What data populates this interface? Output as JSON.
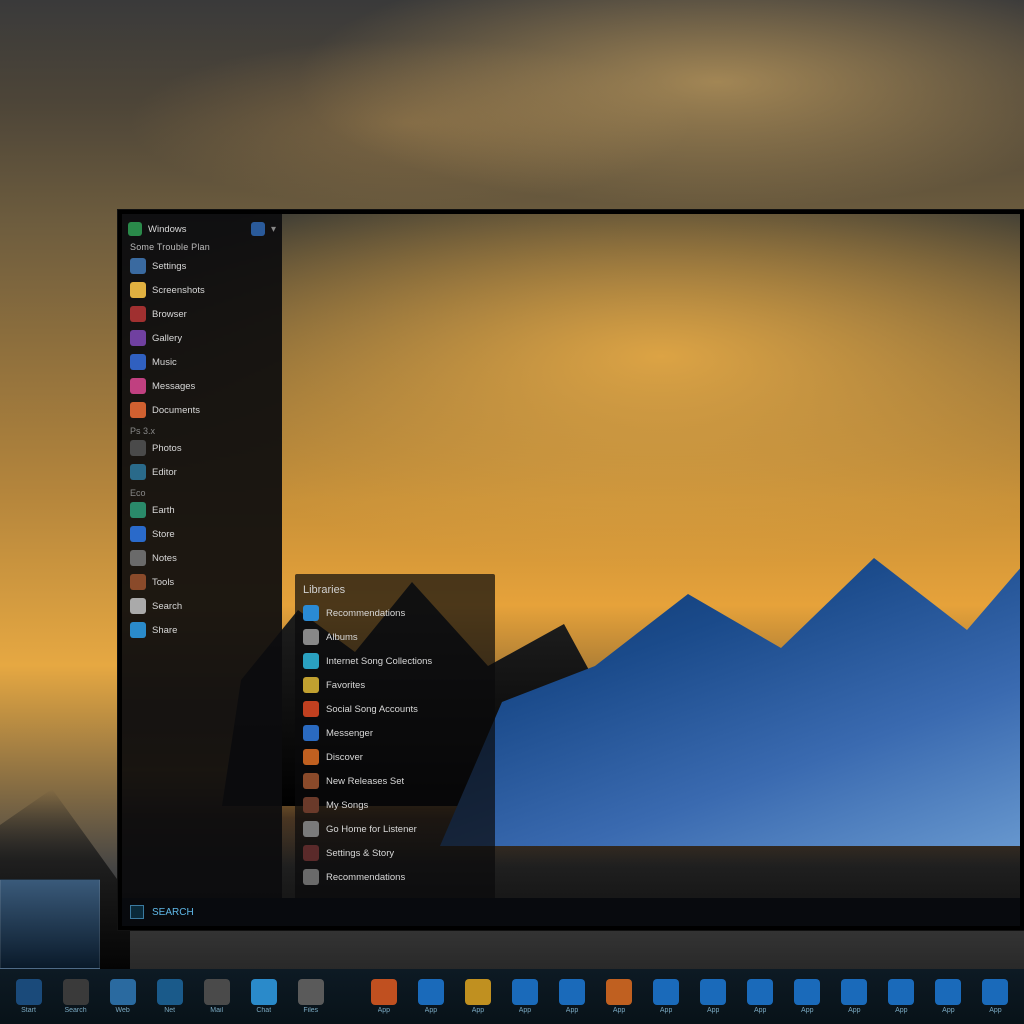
{
  "colors": {
    "accent": "#2a8ad4",
    "panel_bg": "#0c0c0e",
    "text": "#d8d8d8"
  },
  "start_menu": {
    "header_label": "Windows",
    "section_title": "Some Trouble Plan",
    "groups": [
      {
        "label": "",
        "items": [
          {
            "label": "Settings",
            "icon_color": "#3a6aa0"
          },
          {
            "label": "Screenshots",
            "icon_color": "#e0b040"
          },
          {
            "label": "Browser",
            "icon_color": "#a03030"
          },
          {
            "label": "Gallery",
            "icon_color": "#7040a0"
          },
          {
            "label": "Music",
            "icon_color": "#3060c0"
          },
          {
            "label": "Messages",
            "icon_color": "#c04080"
          },
          {
            "label": "Documents",
            "icon_color": "#d06030"
          }
        ]
      },
      {
        "label": "Ps 3.x",
        "items": [
          {
            "label": "Photos",
            "icon_color": "#4a4a4a"
          },
          {
            "label": "Editor",
            "icon_color": "#2a6a8a"
          }
        ]
      },
      {
        "label": "Eco",
        "items": [
          {
            "label": "Earth",
            "icon_color": "#2a8a6a"
          },
          {
            "label": "Store",
            "icon_color": "#2a6aca"
          },
          {
            "label": "Notes",
            "icon_color": "#6a6a6a"
          },
          {
            "label": "Tools",
            "icon_color": "#8a4a2a"
          },
          {
            "label": "Search",
            "icon_color": "#aaaaaa"
          },
          {
            "label": "Share",
            "icon_color": "#2a8aca"
          }
        ]
      }
    ]
  },
  "flyout": {
    "title": "Libraries",
    "items": [
      {
        "label": "Recommendations",
        "icon_color": "#2a8ad4"
      },
      {
        "label": "Albums",
        "icon_color": "#888888"
      },
      {
        "label": "Internet Song Collections",
        "icon_color": "#2aa0c0"
      },
      {
        "label": "Favorites",
        "icon_color": "#c0a030"
      },
      {
        "label": "Social Song Accounts",
        "icon_color": "#c04020"
      },
      {
        "label": "Messenger",
        "icon_color": "#2a6ac0"
      },
      {
        "label": "Discover",
        "icon_color": "#c06020"
      },
      {
        "label": "New Releases Set",
        "icon_color": "#8a4a2a"
      },
      {
        "label": "My Songs",
        "icon_color": "#6a3a2a"
      },
      {
        "label": "Go Home for Listener",
        "icon_color": "#7a7a7a"
      },
      {
        "label": "Settings & Story",
        "icon_color": "#5a2a2a"
      },
      {
        "label": "Recommendations",
        "icon_color": "#6a6a6a"
      }
    ]
  },
  "inner_footer": {
    "label": "SEARCH"
  },
  "taskbar": {
    "items": [
      {
        "name": "start",
        "label": "Start",
        "bg": "#1a4a7a"
      },
      {
        "name": "search",
        "label": "Search",
        "bg": "#3a3a3a"
      },
      {
        "name": "browser",
        "label": "Web",
        "bg": "#2a6aa0"
      },
      {
        "name": "globe",
        "label": "Net",
        "bg": "#1a5a8a"
      },
      {
        "name": "mail",
        "label": "Mail",
        "bg": "#4a4a4a"
      },
      {
        "name": "chat",
        "label": "Chat",
        "bg": "#2a8aca"
      },
      {
        "name": "files",
        "label": "Files",
        "bg": "#5a5a5a"
      },
      {
        "name": "app1",
        "label": "App",
        "bg": "#c05020"
      },
      {
        "name": "app2",
        "label": "App",
        "bg": "#1a6aba"
      },
      {
        "name": "app3",
        "label": "App",
        "bg": "#c09020"
      },
      {
        "name": "app4",
        "label": "App",
        "bg": "#1a6aba"
      },
      {
        "name": "app5",
        "label": "App",
        "bg": "#1a6aba"
      },
      {
        "name": "app6",
        "label": "App",
        "bg": "#c06020"
      },
      {
        "name": "app7",
        "label": "App",
        "bg": "#1a6aba"
      },
      {
        "name": "app8",
        "label": "App",
        "bg": "#1a6aba"
      },
      {
        "name": "app9",
        "label": "App",
        "bg": "#1a6aba"
      },
      {
        "name": "app10",
        "label": "App",
        "bg": "#1a6aba"
      },
      {
        "name": "app11",
        "label": "App",
        "bg": "#1a6aba"
      },
      {
        "name": "app12",
        "label": "App",
        "bg": "#1a6aba"
      },
      {
        "name": "app13",
        "label": "App",
        "bg": "#1a6aba"
      },
      {
        "name": "app14",
        "label": "App",
        "bg": "#1a6aba"
      }
    ]
  }
}
